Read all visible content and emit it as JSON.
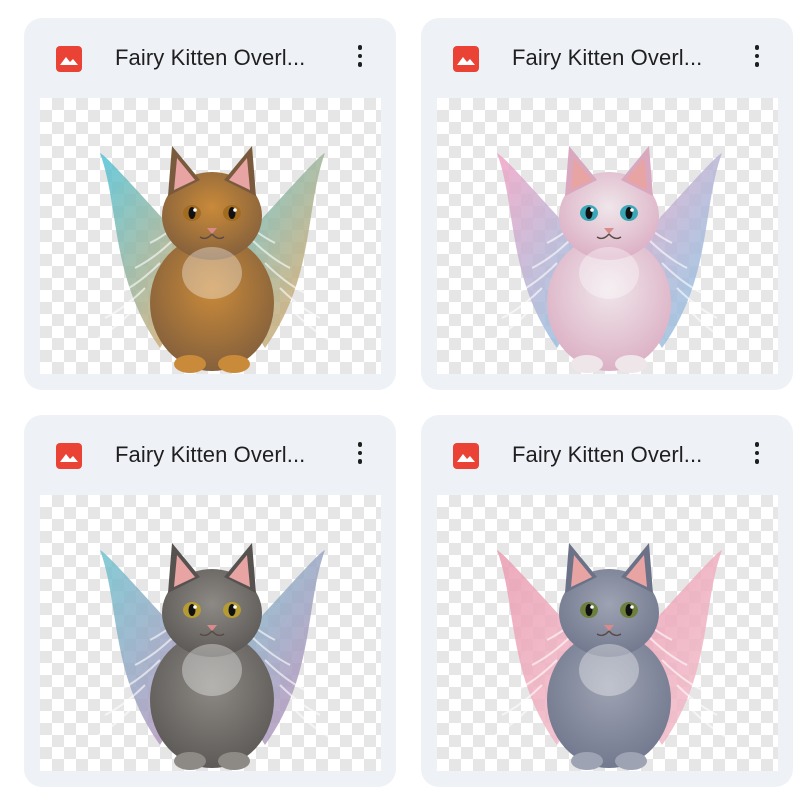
{
  "files": [
    {
      "name": "Fairy Kitten Overl...",
      "icon": "image-file-icon",
      "menu_icon": "more-vert-icon",
      "kitten": {
        "fur": "#c98a3a",
        "fur_dark": "#7a5a3c",
        "wing_a": "#4fc3d9",
        "wing_b": "#f2a65a",
        "eye": "#a36b1f"
      }
    },
    {
      "name": "Fairy Kitten Overl...",
      "icon": "image-file-icon",
      "menu_icon": "more-vert-icon",
      "kitten": {
        "fur": "#efe6ea",
        "fur_dark": "#d9a8bf",
        "wing_a": "#f2a3c4",
        "wing_b": "#7ec8e8",
        "eye": "#3aa7b8"
      }
    },
    {
      "name": "Fairy Kitten Overl...",
      "icon": "image-file-icon",
      "menu_icon": "more-vert-icon",
      "kitten": {
        "fur": "#8d8a86",
        "fur_dark": "#56524f",
        "wing_a": "#6fc4cf",
        "wing_b": "#c58ab8",
        "eye": "#b59b32"
      }
    },
    {
      "name": "Fairy Kitten Overl...",
      "icon": "image-file-icon",
      "menu_icon": "more-vert-icon",
      "kitten": {
        "fur": "#9ea3b3",
        "fur_dark": "#6b7288",
        "wing_a": "#e99bb0",
        "wing_b": "#f4c1cf",
        "eye": "#6d7f3d"
      }
    }
  ]
}
